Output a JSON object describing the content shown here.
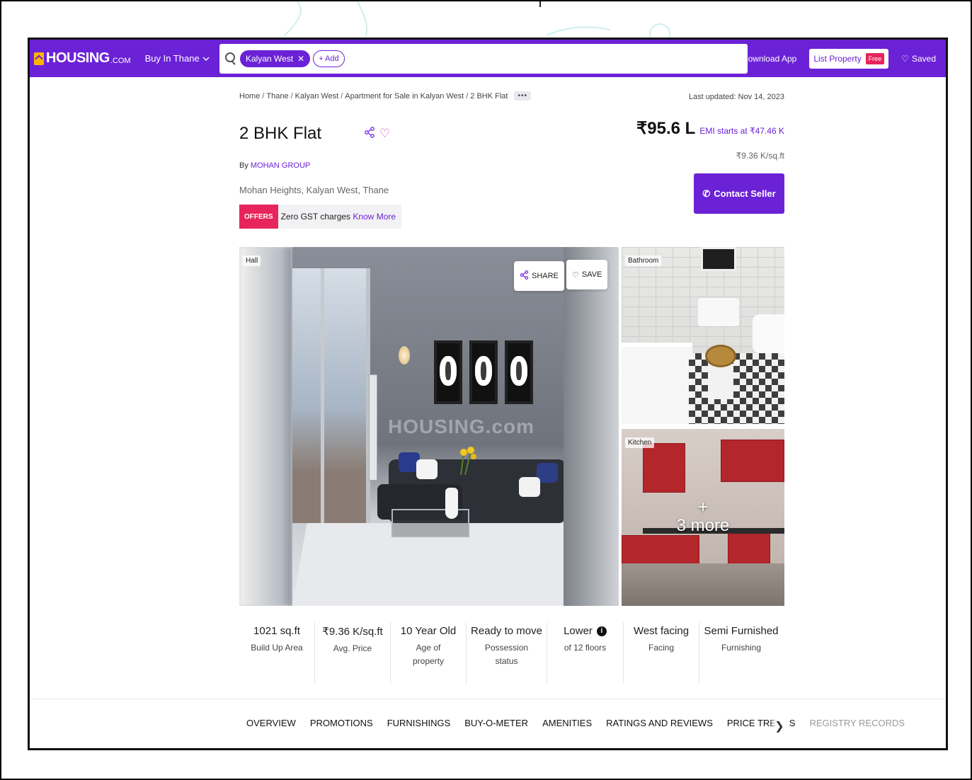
{
  "header": {
    "logo_text": "HOUSING",
    "logo_suffix": ".COM",
    "city_selector": "Buy In Thane",
    "search_chip": "Kalyan West",
    "add_chip": "+ Add",
    "download_app": "Download App",
    "list_property": "List Property",
    "free_badge": "Free",
    "saved": "Saved"
  },
  "breadcrumb": {
    "items": [
      "Home",
      "Thane",
      "Kalyan West",
      "Apartment for Sale in Kalyan West",
      "2 BHK Flat"
    ],
    "more": "•••",
    "last_updated": "Last updated: Nov 14, 2023"
  },
  "listing": {
    "title": "2 BHK Flat",
    "by_label": "By",
    "builder": "MOHAN GROUP",
    "location": "Mohan Heights, Kalyan West, Thane",
    "offer_tag": "OFFERS",
    "offer_text": "Zero GST charges",
    "offer_link": "Know More",
    "price": "₹95.6 L",
    "emi": "EMI starts at ₹47.46 K",
    "price_per_sqft": "₹9.36 K/sq.ft",
    "contact_button": "Contact Seller"
  },
  "gallery": {
    "main_label": "Hall",
    "share_label": "SHARE",
    "save_label": "SAVE",
    "watermark": "HOUSING.com",
    "side1_label": "Bathroom",
    "side2_label": "Kitchen",
    "more_plus": "+",
    "more_text": "3 more"
  },
  "stats": [
    {
      "value": "1021 sq.ft",
      "label": "Build Up Area"
    },
    {
      "value": "₹9.36 K/sq.ft",
      "label": "Avg. Price"
    },
    {
      "value": "10 Year Old",
      "label": "Age of property"
    },
    {
      "value": "Ready to move",
      "label": "Possession status"
    },
    {
      "value": "Lower",
      "label": "of 12 floors"
    },
    {
      "value": "West facing",
      "label": "Facing"
    },
    {
      "value": "Semi Furnished",
      "label": "Furnishing"
    }
  ],
  "tabs": [
    "OVERVIEW",
    "PROMOTIONS",
    "FURNISHINGS",
    "BUY-O-METER",
    "AMENITIES",
    "RATINGS AND REVIEWS",
    "PRICE TRENDS",
    "REGISTRY RECORDS"
  ],
  "colors": {
    "brand_purple": "#6b22d6",
    "offer_pink": "#e7245b",
    "logo_yellow": "#ffb400"
  }
}
